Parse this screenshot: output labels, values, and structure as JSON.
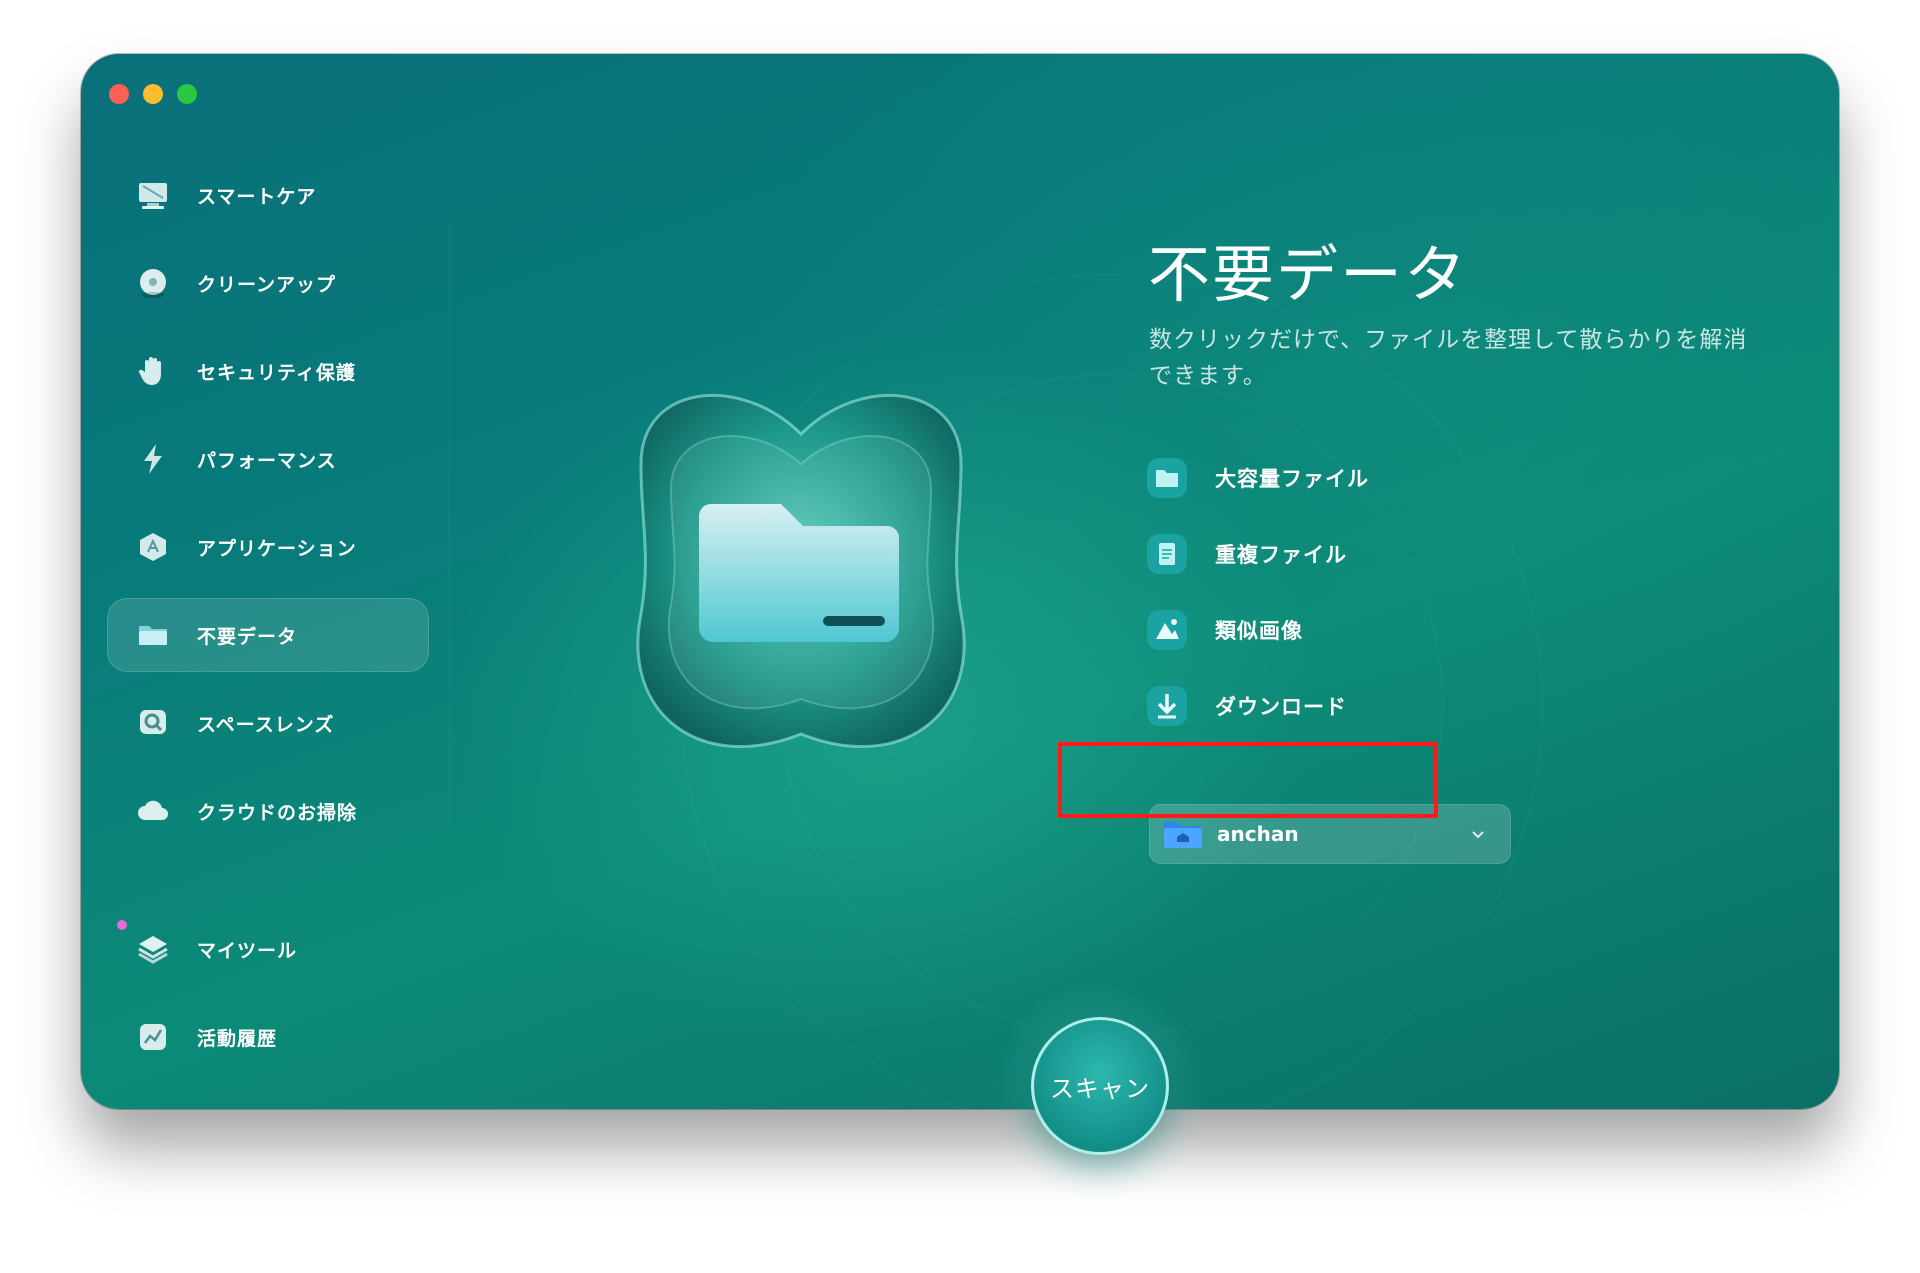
{
  "window": {
    "traffic_lights": [
      "close",
      "minimize",
      "zoom"
    ]
  },
  "sidebar": {
    "items": [
      {
        "label": "スマートケア",
        "icon": "monitor-icon"
      },
      {
        "label": "クリーンアップ",
        "icon": "disc-icon"
      },
      {
        "label": "セキュリティ保護",
        "icon": "hand-icon"
      },
      {
        "label": "パフォーマンス",
        "icon": "lightning-icon"
      },
      {
        "label": "アプリケーション",
        "icon": "app-icon"
      },
      {
        "label": "不要データ",
        "icon": "folder-icon",
        "active": true
      },
      {
        "label": "スペースレンズ",
        "icon": "lens-icon"
      },
      {
        "label": "クラウドのお掃除",
        "icon": "cloud-icon"
      }
    ],
    "bottom_items": [
      {
        "label": "マイツール",
        "icon": "layers-icon",
        "notification_dot": true
      },
      {
        "label": "活動履歴",
        "icon": "chart-icon"
      }
    ]
  },
  "main": {
    "title": "不要データ",
    "description": "数クリックだけで、ファイルを整理して散らかりを解消できます。",
    "features": [
      {
        "label": "大容量ファイル",
        "icon": "large-file-icon"
      },
      {
        "label": "重複ファイル",
        "icon": "duplicate-file-icon"
      },
      {
        "label": "類似画像",
        "icon": "similar-image-icon"
      },
      {
        "label": "ダウンロード",
        "icon": "download-icon"
      }
    ],
    "folder_selector": {
      "value": "anchan",
      "icon": "home-folder-icon"
    },
    "scan_button": "スキャン"
  },
  "colors": {
    "background": "#0a7a78",
    "accent": "#2cb8ae",
    "highlight_frame": "#ff1a1a"
  }
}
